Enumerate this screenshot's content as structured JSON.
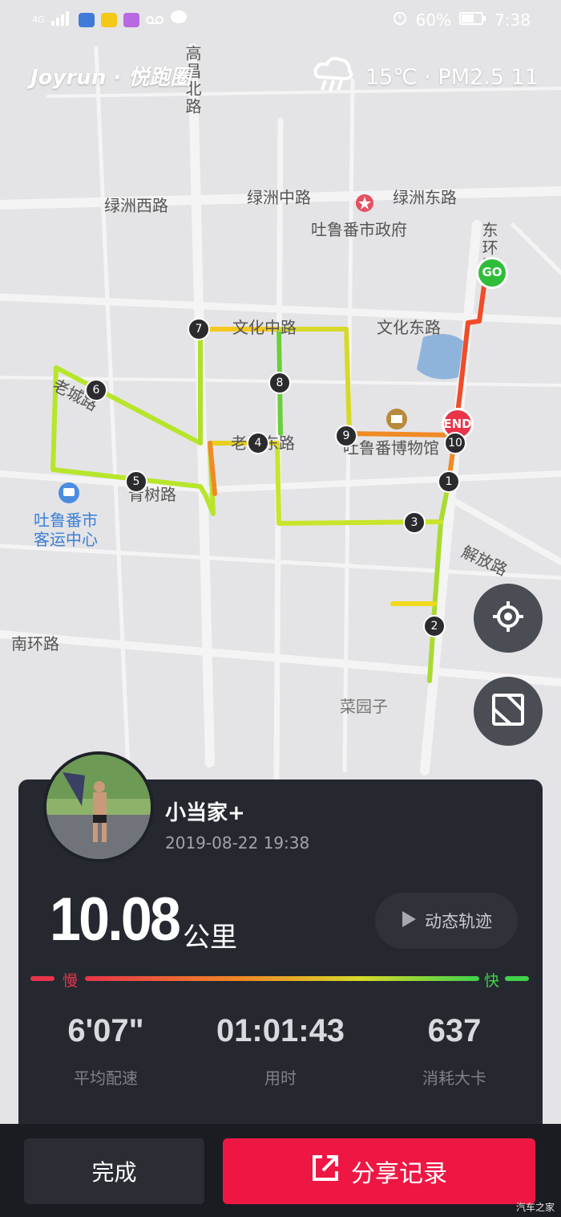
{
  "status_bar": {
    "network": "4G",
    "battery": "60%",
    "time": "7:38"
  },
  "header": {
    "logo": "Joyrun · 悦跑圈",
    "weather": "15℃ · PM2.5 11"
  },
  "map": {
    "labels": [
      "高昌北路",
      "绿洲西路",
      "绿洲中路",
      "绿洲东路",
      "吐鲁番市政府",
      "东环路",
      "文化中路",
      "文化东路",
      "老城路",
      "老城东路",
      "吐鲁番博物馆",
      "青树路",
      "吐鲁番市",
      "客运中心",
      "解放路",
      "南环路",
      "菜园子"
    ],
    "start_marker": "GO",
    "end_marker": "END",
    "km_markers": [
      "1",
      "2",
      "3",
      "4",
      "5",
      "6",
      "7",
      "8",
      "9",
      "10"
    ]
  },
  "record": {
    "username": "小当家+",
    "datetime": "2019-08-22 19:38",
    "distance": "10.08",
    "distance_unit": "公里",
    "replay_label": "动态轨迹",
    "slow_label": "慢",
    "fast_label": "快",
    "stats": [
      {
        "value": "6'07\"",
        "label": "平均配速"
      },
      {
        "value": "01:01:43",
        "label": "用时"
      },
      {
        "value": "637",
        "label": "消耗大卡"
      }
    ]
  },
  "actions": {
    "done": "完成",
    "share": "分享记录"
  },
  "watermark": "汽车之家",
  "colors": {
    "accent": "#ee1744",
    "slow": "#e8354a",
    "fast": "#3fd24a",
    "card": "#262830"
  }
}
